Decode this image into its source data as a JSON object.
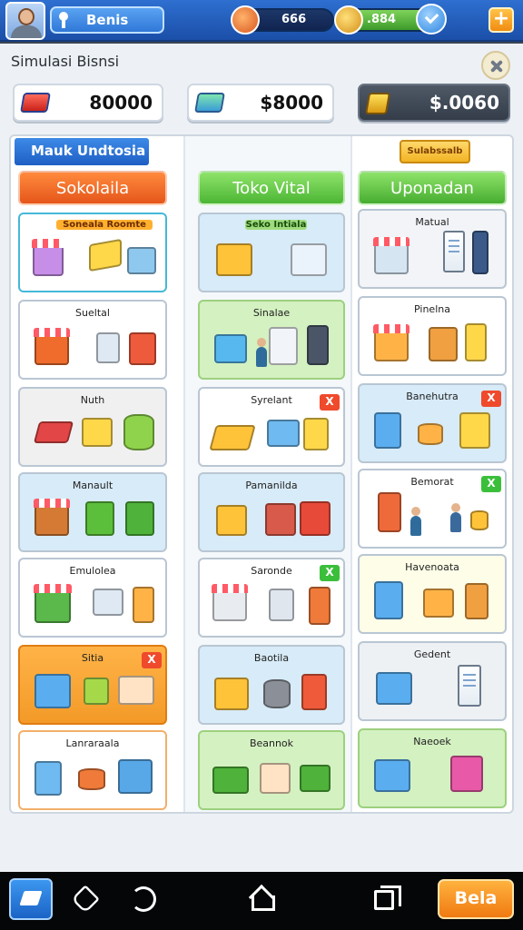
{
  "header": {
    "player_name": "Benis",
    "resource_a": "666",
    "resource_b": ".884",
    "plus_label": "+"
  },
  "subtitle": "Simulasi Bisnsi",
  "currencies": [
    "80000",
    "$8000",
    "$.0060"
  ],
  "columns": [
    {
      "tag": "Mauk Undtosia",
      "button": "Sokolaila",
      "cards": [
        {
          "label": "Soneala Roomte",
          "style": "tag"
        },
        {
          "label": "Sueltal"
        },
        {
          "label": "Nuth"
        },
        {
          "label": "Manault"
        },
        {
          "label": "Emulolea"
        },
        {
          "label": "Sitia",
          "badge": "X"
        },
        {
          "label": "Lanraraala"
        }
      ]
    },
    {
      "tag": "",
      "button": "Toko Vital",
      "cards": [
        {
          "label": "Seko Intiala",
          "style": "tagg"
        },
        {
          "label": "Sinalae"
        },
        {
          "label": "Syrelant",
          "badge": "X"
        },
        {
          "label": "Pamanilda"
        },
        {
          "label": "Saronde",
          "badge": "X"
        },
        {
          "label": "Baotila"
        },
        {
          "label": "Beannok"
        }
      ]
    },
    {
      "tag": "Sulabssalb",
      "button": "Uponadan",
      "cards": [
        {
          "label": "Matual"
        },
        {
          "label": "Pinelna"
        },
        {
          "label": "Banehutra",
          "badge": "X"
        },
        {
          "label": "Bemorat",
          "badge": "X"
        },
        {
          "label": "Havenoata"
        },
        {
          "label": "Gedent"
        },
        {
          "label": "Naeoek"
        }
      ]
    }
  ],
  "bottom_nav": {
    "action_label": "Bela"
  }
}
